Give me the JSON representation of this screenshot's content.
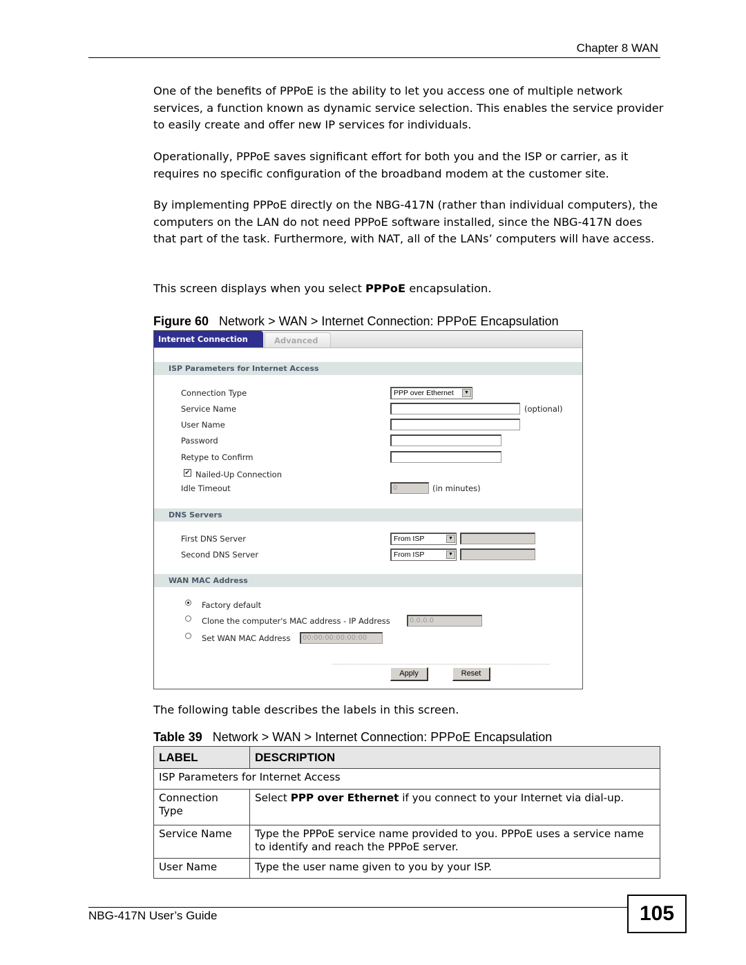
{
  "header": {
    "chapter": "Chapter 8 WAN"
  },
  "paragraphs": [
    "One of the benefits of PPPoE is the ability to let you access one of multiple network services, a function known as dynamic service selection. This enables the service provider to easily create and offer new IP services for individuals.",
    "Operationally, PPPoE saves significant effort for both you and the ISP or carrier, as it requires no specific configuration of the broadband modem at the customer site.",
    "By implementing PPPoE directly on the NBG-417N (rather than individual computers), the computers on the LAN do not need PPPoE software installed, since the NBG-417N does that part of the task. Furthermore, with NAT, all of the LANs’ computers will have access."
  ],
  "select_sentence": {
    "before": "This screen displays when you select ",
    "bold": "PPPoE",
    "after": " encapsulation."
  },
  "figure": {
    "label": "Figure 60",
    "title": "Network > WAN > Internet Connection: PPPoE Encapsulation"
  },
  "screen": {
    "tabs": [
      {
        "label": "Internet Connection",
        "active": true
      },
      {
        "label": "Advanced",
        "active": false
      }
    ],
    "isp_section": {
      "title": "ISP Parameters for Internet Access",
      "connection_type_label": "Connection Type",
      "connection_type_value": "PPP over Ethernet",
      "service_name_label": "Service Name",
      "service_name_value": "",
      "optional_note": "(optional)",
      "user_name_label": "User Name",
      "user_name_value": "",
      "password_label": "Password",
      "password_value": "",
      "retype_label": "Retype to Confirm",
      "retype_value": "",
      "nailed_up_label": "Nailed-Up Connection",
      "nailed_up_checked": true,
      "idle_timeout_label": "Idle Timeout",
      "idle_timeout_value": "0",
      "idle_timeout_unit": "(in minutes)"
    },
    "dns_section": {
      "title": "DNS Servers",
      "first_label": "First DNS Server",
      "first_value": "From ISP",
      "first_ip": "",
      "second_label": "Second DNS Server",
      "second_value": "From ISP",
      "second_ip": ""
    },
    "mac_section": {
      "title": "WAN MAC Address",
      "options": [
        {
          "label": "Factory default",
          "selected": true
        },
        {
          "label": "Clone the computer's MAC address - IP Address",
          "selected": false,
          "field": "0.0.0.0"
        },
        {
          "label": "Set WAN MAC Address",
          "selected": false,
          "field": "00:00:00:00:00:00"
        }
      ]
    },
    "buttons": {
      "apply": "Apply",
      "reset": "Reset"
    },
    "icons": {
      "dropdown": "▼",
      "check": "✔"
    }
  },
  "after_figure_text": "The following table describes the labels in this screen.",
  "table": {
    "label": "Table 39",
    "title": "Network > WAN > Internet Connection: PPPoE Encapsulation",
    "headers": [
      "LABEL",
      "DESCRIPTION"
    ],
    "section_row": "ISP Parameters for Internet Access",
    "rows": [
      {
        "label": "Connection Type",
        "desc_before": "Select ",
        "desc_bold": "PPP over Ethernet",
        "desc_after": " if you connect to your Internet via dial-up."
      },
      {
        "label": "Service Name",
        "desc_before": "Type the PPPoE service name provided to you. PPPoE uses a service name to identify and reach the PPPoE server.",
        "desc_bold": "",
        "desc_after": ""
      },
      {
        "label": "User Name",
        "desc_before": "Type the user name given to you by your ISP.",
        "desc_bold": "",
        "desc_after": ""
      }
    ]
  },
  "footer": {
    "guide": "NBG-417N User’s Guide",
    "page_number": "105"
  }
}
